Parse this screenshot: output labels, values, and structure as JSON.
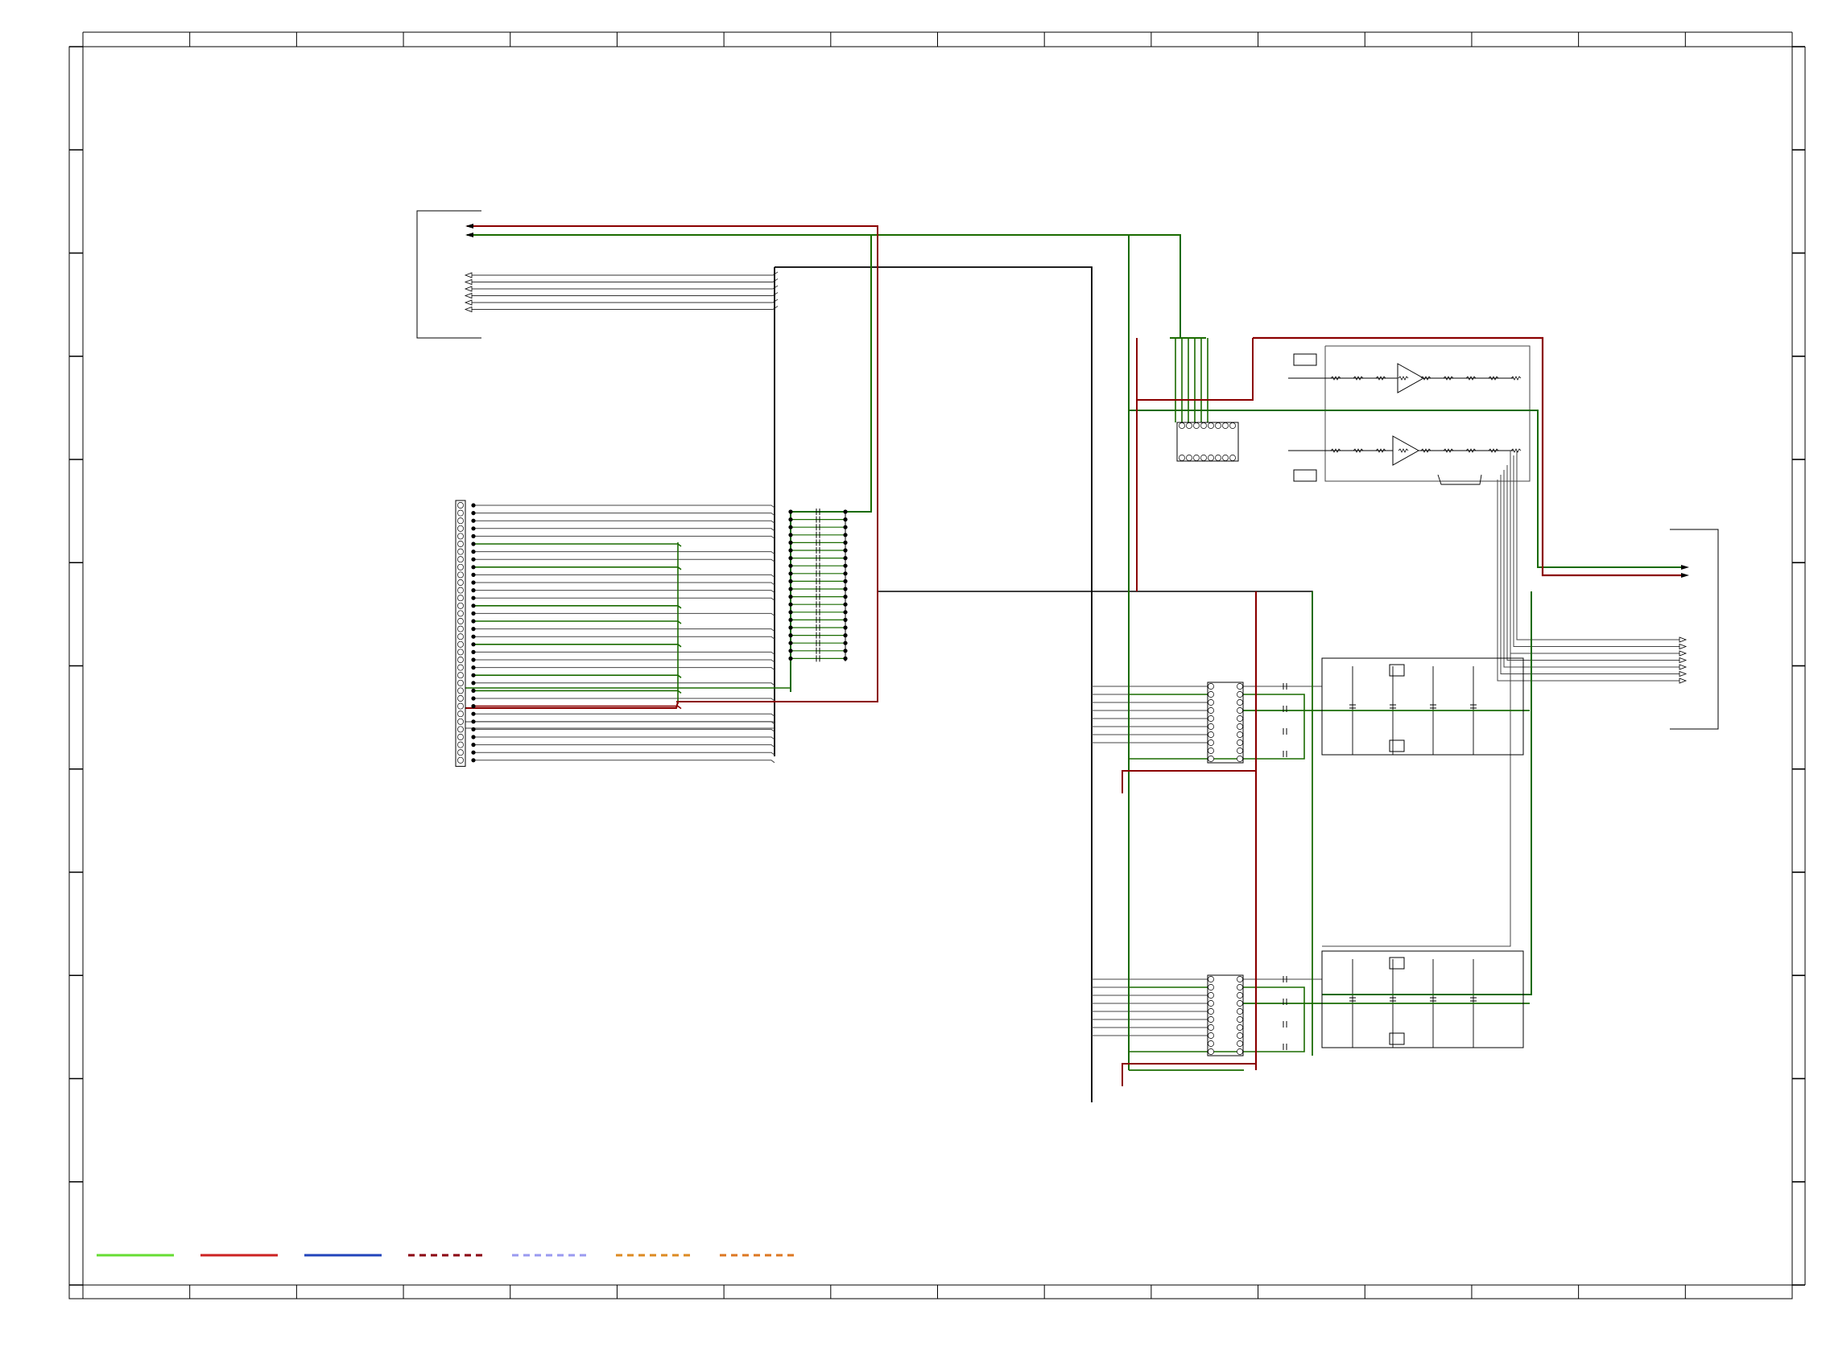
{
  "sheet": {
    "frame": "schematic-border",
    "zones_top_bottom": 16,
    "zones_left_right": 12
  },
  "colors": {
    "black_wire": "#000000",
    "green_wire": "#1a6b00",
    "red_wire": "#8b0000",
    "grey_wire": "#555555",
    "legend_light_green": "#66dd33",
    "legend_red": "#cc2222",
    "legend_blue": "#2244bb",
    "legend_dashed_dark_red": "#8b0010",
    "legend_dashed_lavender": "#9a9af0",
    "legend_dashed_orange_1": "#dd8a22",
    "legend_dashed_orange_2": "#dd7722"
  },
  "legend": [
    {
      "name": "legend-line-light-green",
      "color": "legend_light_green",
      "dashed": false
    },
    {
      "name": "legend-line-red",
      "color": "legend_red",
      "dashed": false
    },
    {
      "name": "legend-line-blue",
      "color": "legend_blue",
      "dashed": false
    },
    {
      "name": "legend-line-dark-red-dashed",
      "color": "legend_dashed_dark_red",
      "dashed": true
    },
    {
      "name": "legend-line-lavender-dashed",
      "color": "legend_dashed_lavender",
      "dashed": true
    },
    {
      "name": "legend-line-orange-dashed-1",
      "color": "legend_dashed_orange_1",
      "dashed": true
    },
    {
      "name": "legend-line-orange-dashed-2",
      "color": "legend_dashed_orange_2",
      "dashed": true
    }
  ],
  "components": {
    "connector_pins": 34,
    "cap_array_rows": 20,
    "top_ic_pins_per_side": 8,
    "mid_ic_pins_per_side": 10,
    "bottom_ic_pins_per_side": 10,
    "output_connector_pins": 7
  }
}
